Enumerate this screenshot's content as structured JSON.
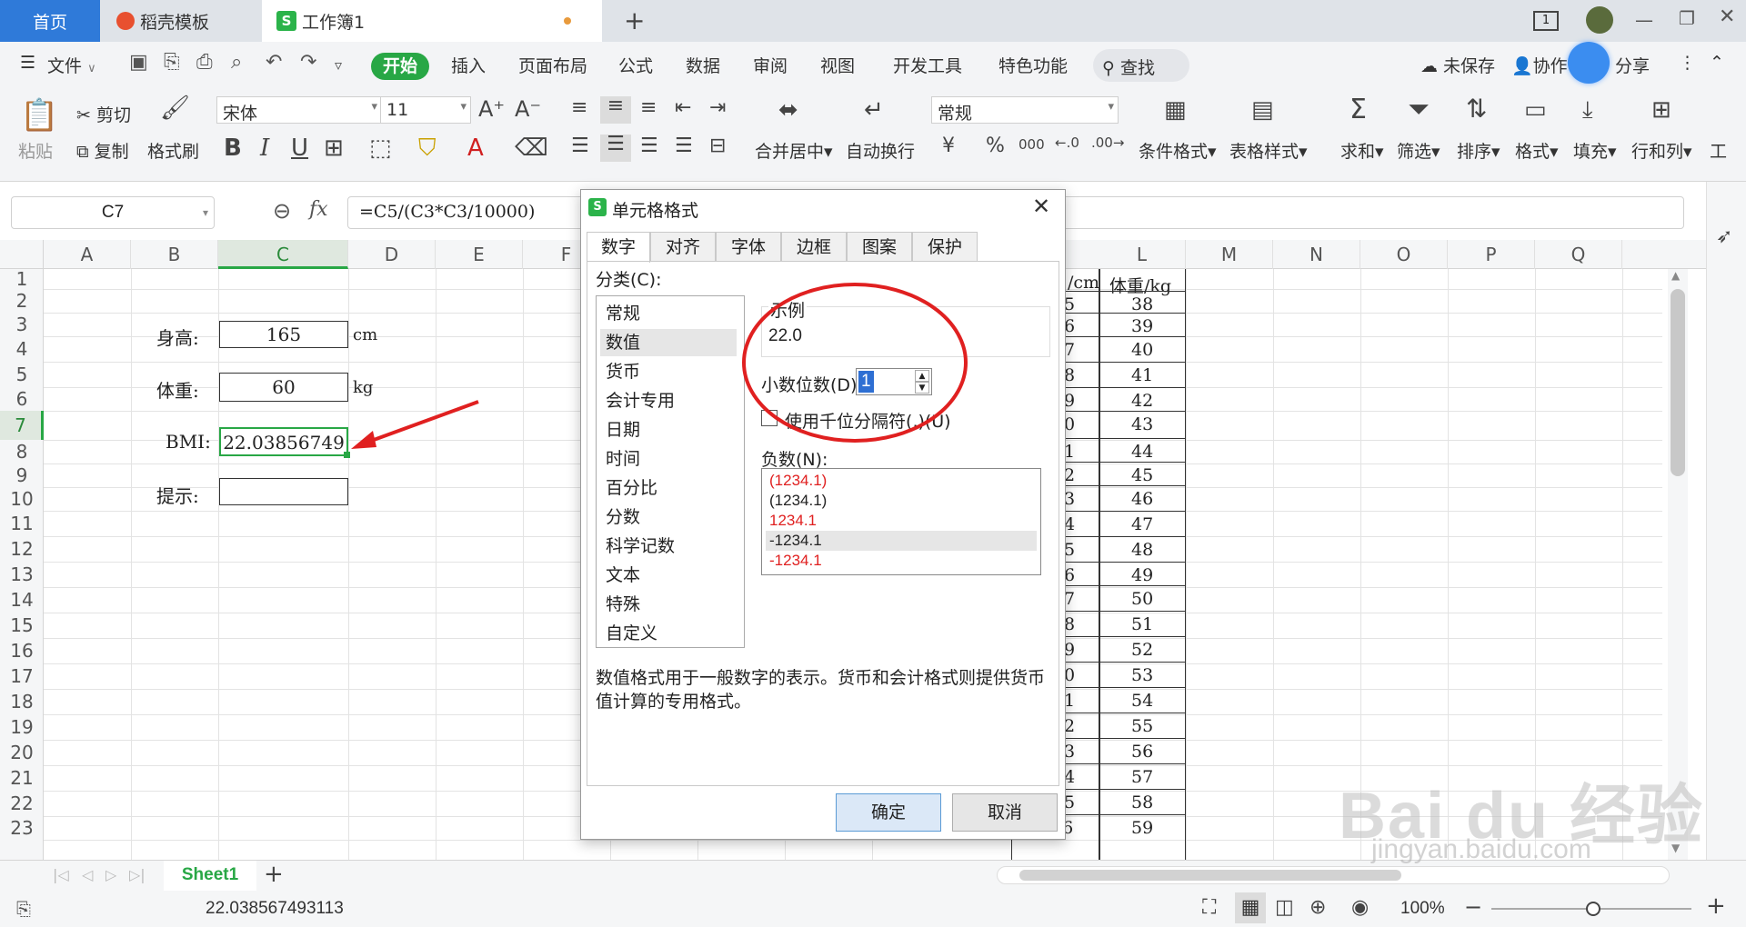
{
  "tabs": [
    {
      "label": "首页"
    },
    {
      "label": "稻壳模板"
    },
    {
      "label": "工作簿1"
    }
  ],
  "menu": {
    "file": "文件",
    "items": [
      "开始",
      "插入",
      "页面布局",
      "公式",
      "数据",
      "审阅",
      "视图",
      "开发工具",
      "特色功能"
    ],
    "search": "查找",
    "unsaved": "未保存",
    "collab": "协作",
    "share": "分享"
  },
  "ribbon": {
    "paste": "粘贴",
    "cut": "剪切",
    "copy": "复制",
    "format_painter": "格式刷",
    "font_name": "宋体",
    "font_size": "11",
    "merge_center": "合并居中",
    "wrap": "自动换行",
    "number_format": "常规",
    "cond_format": "条件格式",
    "table_style": "表格样式",
    "sum": "求和",
    "filter": "筛选",
    "sort": "排序",
    "format": "格式",
    "fill": "填充",
    "rowcol": "行和列",
    "work": "工"
  },
  "formula": {
    "name_box": "C7",
    "fx": "fx",
    "value": "=C5/(C3*C3/10000)"
  },
  "columns": [
    "A",
    "B",
    "C",
    "D",
    "E",
    "F",
    "",
    "",
    "",
    "",
    "",
    "L",
    "M",
    "N",
    "O",
    "P",
    "Q"
  ],
  "rows": [
    "1",
    "2",
    "3",
    "4",
    "5",
    "6",
    "7",
    "8",
    "9",
    "10",
    "11",
    "12",
    "13",
    "14",
    "15",
    "16",
    "17",
    "18",
    "19",
    "20",
    "21",
    "22",
    "23"
  ],
  "cells": {
    "height_label": "身高:",
    "height_value": "165",
    "height_unit": "cm",
    "weight_label": "体重:",
    "weight_value": "60",
    "weight_unit": "kg",
    "bmi_label": "BMI:",
    "bmi_value": "22.03856749",
    "hint_label": "提示:"
  },
  "right_table": {
    "header_k": "/cm",
    "header_l": "体重/kg",
    "k_values": [
      "5",
      "6",
      "7",
      "8",
      "9",
      "0",
      "1",
      "2",
      "3",
      "4",
      "5",
      "6",
      "7",
      "8",
      "9",
      "0",
      "1",
      "2",
      "3",
      "4",
      "5",
      "176"
    ],
    "l_values": [
      "38",
      "39",
      "40",
      "41",
      "42",
      "43",
      "44",
      "45",
      "46",
      "47",
      "48",
      "49",
      "50",
      "51",
      "52",
      "53",
      "54",
      "55",
      "56",
      "57",
      "58",
      "59"
    ]
  },
  "dialog": {
    "title": "单元格格式",
    "tabs": [
      "数字",
      "对齐",
      "字体",
      "边框",
      "图案",
      "保护"
    ],
    "category_label": "分类(C):",
    "categories": [
      "常规",
      "数值",
      "货币",
      "会计专用",
      "日期",
      "时间",
      "百分比",
      "分数",
      "科学记数",
      "文本",
      "特殊",
      "自定义"
    ],
    "sample_label": "示例",
    "sample_value": "22.0",
    "decimals_label": "小数位数(D):",
    "decimals_value": "1",
    "thousands_label": "使用千位分隔符(,)(U)",
    "negative_label": "负数(N):",
    "negatives": [
      "(1234.1)",
      "(1234.1)",
      "1234.1",
      "-1234.1",
      "-1234.1"
    ],
    "description": "数值格式用于一般数字的表示。货币和会计格式则提供货币值计算的专用格式。",
    "ok": "确定",
    "cancel": "取消"
  },
  "sheetbar": {
    "sheet": "Sheet1",
    "add": "+"
  },
  "status": {
    "value": "22.038567493113",
    "zoom": "100%"
  },
  "watermark": {
    "brand": "Bai du 经验",
    "url": "jingyan.baidu.com"
  },
  "colors": {
    "accent_green": "#28a745",
    "annotation_red": "#e02020",
    "neg_red": "#e02020"
  }
}
